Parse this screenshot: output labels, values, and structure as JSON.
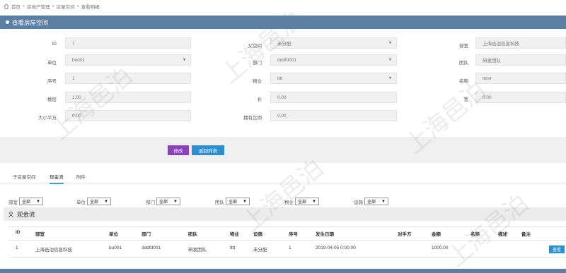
{
  "breadcrumb": [
    "首页",
    "房地产管理",
    "房屋空间",
    "查看明细"
  ],
  "page_title": "查看房屋空间",
  "form": {
    "id": {
      "label": "ID",
      "value": "1"
    },
    "parent": {
      "label": "父空间",
      "value": "未分配"
    },
    "company": {
      "label": "部室",
      "value": "上海邑泊信息科技"
    },
    "unit": {
      "label": "单位",
      "value": "bu001"
    },
    "dept": {
      "label": "部门",
      "value": "dddfd001"
    },
    "team": {
      "label": "团队",
      "value": "研发团队"
    },
    "seq": {
      "label": "序号",
      "value": "1"
    },
    "property": {
      "label": "物业",
      "value": "tttt"
    },
    "name": {
      "label": "名称",
      "value": "ttest"
    },
    "floor": {
      "label": "楼层",
      "value": "1.00"
    },
    "length": {
      "label": "长",
      "value": "0.00"
    },
    "width": {
      "label": "宽",
      "value": "0.00"
    },
    "area": {
      "label": "大小平方",
      "value": "0.00"
    },
    "ratio": {
      "label": "拥有比例",
      "value": "0.00"
    }
  },
  "buttons": {
    "edit": "修改",
    "back": "返回列表"
  },
  "tabs": [
    "子房屋空间",
    "现金流",
    "附件"
  ],
  "filters": [
    {
      "label": "部室",
      "value": "全部"
    },
    {
      "label": "单位",
      "value": "全部"
    },
    {
      "label": "部门",
      "value": "全部"
    },
    {
      "label": "团队",
      "value": "全部"
    },
    {
      "label": "物业",
      "value": "全部"
    },
    {
      "label": "设施",
      "value": "全部"
    }
  ],
  "section_title": "现金流",
  "table": {
    "headers": [
      "ID",
      "部室",
      "单位",
      "部门",
      "团队",
      "物业",
      "设施",
      "序号",
      "发生日期",
      "对手方",
      "金额",
      "名称",
      "描述",
      "备注"
    ],
    "rows": [
      [
        "1",
        "上海邑泊信息科技",
        "bu001",
        "dddfd001",
        "研发团队",
        "tttt",
        "未分配",
        "1",
        "2019-04-05 0:00:00",
        "",
        "1000.00",
        "",
        "",
        ""
      ]
    ],
    "view_label": "查看"
  },
  "watermark": "上海邑泊"
}
